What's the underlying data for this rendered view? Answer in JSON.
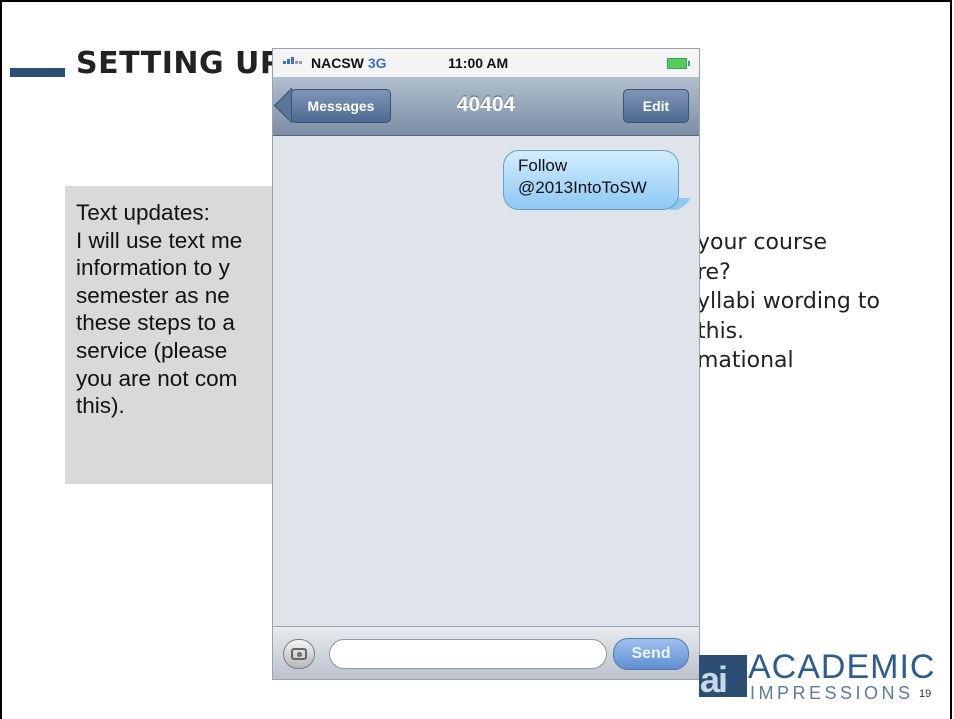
{
  "slide": {
    "title": "SETTING UP",
    "text_box_lines": [
      "Text updates:",
      "I will use text me",
      "information to y",
      "semester as ne",
      "these steps to a",
      "service (please",
      "you are not com",
      "this)."
    ],
    "right_text_lines": [
      "your course",
      "re?",
      "yllabi wording to",
      "this.",
      "mational"
    ],
    "page_number": "19"
  },
  "phone": {
    "carrier": "NACSW",
    "network": "3G",
    "time": "11:00 AM",
    "back_button": "Messages",
    "conversation_title": "40404",
    "edit_button": "Edit",
    "message_lines": [
      "Follow",
      "@2013IntoToSW"
    ],
    "send_button": "Send",
    "icons": {
      "signal": "signal-bars-icon",
      "battery": "battery-icon",
      "camera": "camera-icon"
    }
  },
  "logo": {
    "mark": "ai",
    "name_top": "ACADEMIC",
    "name_bottom": "IMPRESSIONS"
  },
  "colors": {
    "accent": "#2d4e73",
    "text_box_bg": "#d9d9d9",
    "nav_bar": "#7c8ea6",
    "bubble": "#8dc8f4",
    "logo_blue": "#2d5d8e"
  }
}
